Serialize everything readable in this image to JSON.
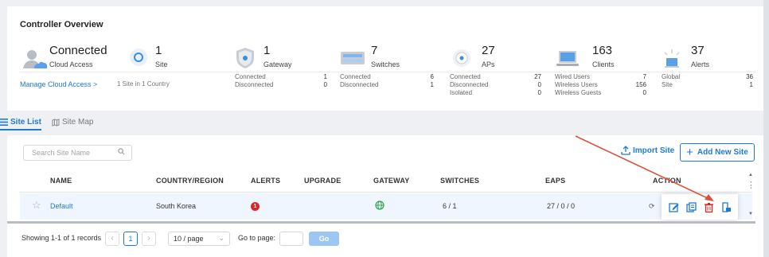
{
  "overview": {
    "title": "Controller Overview",
    "cloud": {
      "status": "Connected",
      "label": "Cloud Access",
      "link": "Manage Cloud Access >"
    },
    "sites": {
      "count": "1",
      "label": "Site",
      "detail": "1 Site in 1 Country"
    },
    "gateway": {
      "count": "1",
      "label": "Gateway",
      "rows": [
        {
          "k": "Connected",
          "v": "1"
        },
        {
          "k": "Disconnected",
          "v": "0"
        }
      ]
    },
    "switches": {
      "count": "7",
      "label": "Switches",
      "rows": [
        {
          "k": "Connected",
          "v": "6"
        },
        {
          "k": "Disconnected",
          "v": "1"
        }
      ]
    },
    "aps": {
      "count": "27",
      "label": "APs",
      "rows": [
        {
          "k": "Connected",
          "v": "27"
        },
        {
          "k": "Disconnected",
          "v": "0"
        },
        {
          "k": "Isolated",
          "v": "0"
        }
      ]
    },
    "clients": {
      "count": "163",
      "label": "Clients",
      "rows": [
        {
          "k": "Wired Users",
          "v": "7"
        },
        {
          "k": "Wireless Users",
          "v": "156"
        },
        {
          "k": "Wireless Guests",
          "v": "0"
        }
      ]
    },
    "alerts": {
      "count": "37",
      "label": "Alerts",
      "rows": [
        {
          "k": "Global",
          "v": "36"
        },
        {
          "k": "Site",
          "v": "1"
        }
      ]
    }
  },
  "tabs": {
    "site_list": "Site List",
    "site_map": "Site Map"
  },
  "toolbar": {
    "search_placeholder": "Search Site Name",
    "import_label": "Import Site",
    "add_label": "Add New Site"
  },
  "table": {
    "headers": [
      "NAME",
      "COUNTRY/REGION",
      "ALERTS",
      "UPGRADE",
      "GATEWAY",
      "SWITCHES",
      "EAPS",
      "ACTION"
    ],
    "rows": [
      {
        "name": "Default",
        "country": "South Korea",
        "alerts": "1",
        "switches": "6 / 1",
        "eaps": "27 / 0 / 0"
      }
    ]
  },
  "pagination": {
    "summary": "Showing 1-1 of 1 records",
    "current_page": "1",
    "page_size": "10 / page",
    "goto_label": "Go to page:",
    "go_label": "Go"
  },
  "colors": {
    "accent": "#1e7ad6",
    "alert": "#e02424",
    "gateway_online": "#2ba84a",
    "annotation_arrow": "#d9533b"
  }
}
